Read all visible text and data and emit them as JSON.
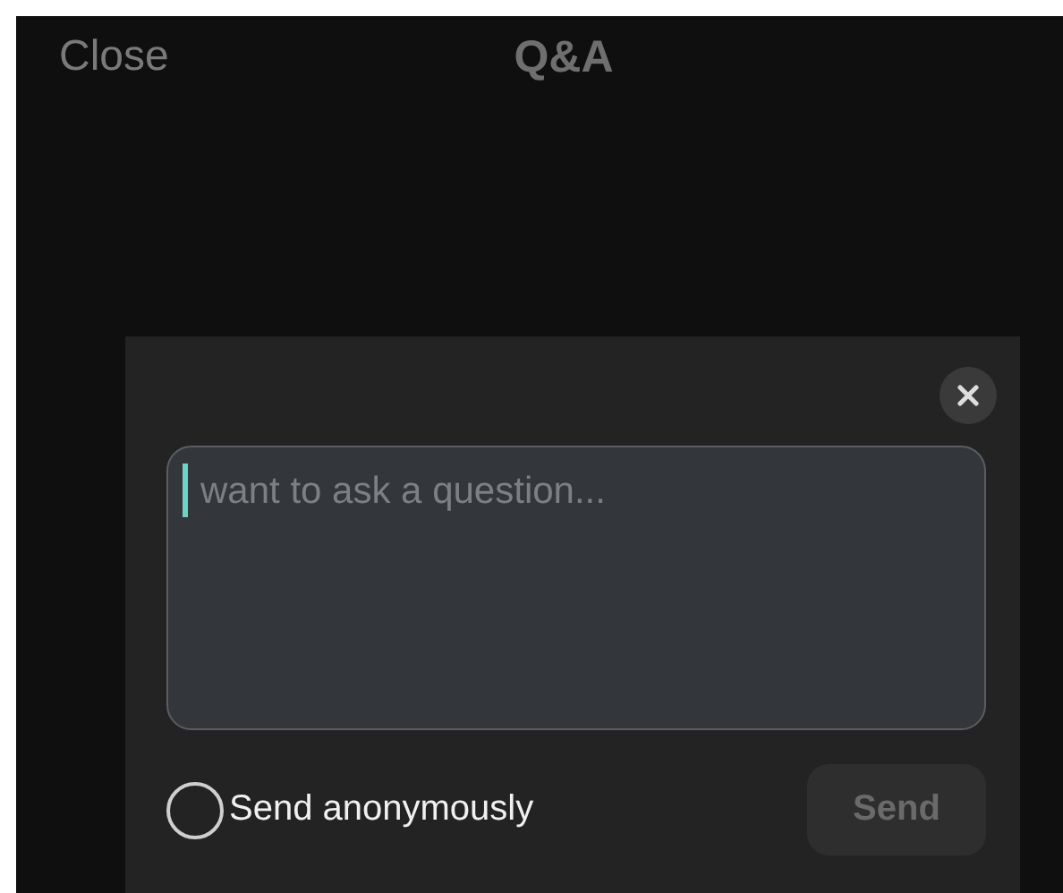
{
  "header": {
    "close": "Close",
    "title": "Q&A"
  },
  "dialog": {
    "question_field": {
      "placeholder": "want to ask a question...",
      "focused": true
    },
    "anonymous": {
      "label": "Send anonymously",
      "checked": false
    },
    "send_button": {
      "label": "Send",
      "disabled": true
    }
  }
}
